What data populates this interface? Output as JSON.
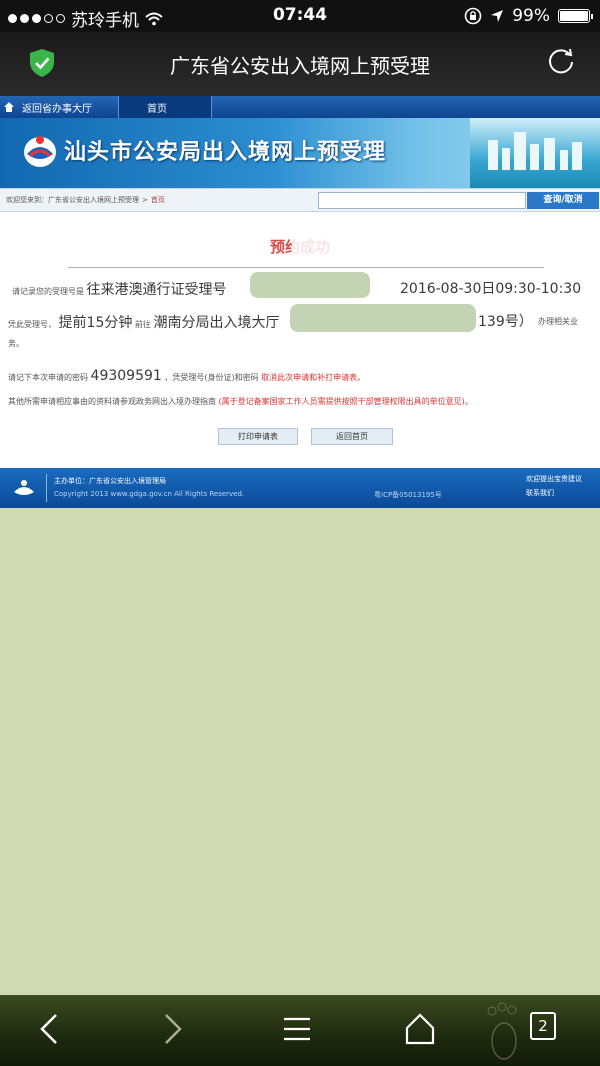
{
  "status_bar": {
    "carrier": "苏玲手机",
    "time": "07:44",
    "battery": "99%",
    "battery_level": 0.99
  },
  "browser": {
    "title": "广东省公安出入境网上预受理"
  },
  "site": {
    "nav": {
      "back_label": "返回省办事大厅",
      "home_label": "首页"
    },
    "banner_title": "汕头市公安局出入境网上预受理",
    "breadcrumb": {
      "prefix": "欢迎您来到：广东省公安出入境网上预受理",
      "separator": ">",
      "current": "首页"
    },
    "search_button": "查询/取消"
  },
  "content": {
    "heading": "预约成功",
    "line1_prefix": "请记录您的受理号是",
    "line1_business": "往来港澳通行证受理号",
    "line1_datetime": "2016-08-30日09:30-10:30",
    "line2_prefix": "凭此受理号，",
    "line2_early": "提前15分钟",
    "line2_goto": "前往",
    "line2_place": "潮南分局出入境大厅",
    "line2_addr_end": "139号）",
    "line2_suffix": "办理相关业",
    "line3": "务。",
    "line4_prefix": "请记下本次申请的密码",
    "line4_password": "49309591",
    "line4_mid": "，凭受理号(身份证)和密码",
    "line4_link": "取消此次申请和补打申请表。",
    "line5_prefix": "其他所需申请相应事由的资料请参观政务网出入境办理指南",
    "line5_red": "(属于登记备案国家工作人员需提供按照干部管理权限出具的单位意见)。",
    "buttons": {
      "print": "打印申请表",
      "home": "返回首页"
    }
  },
  "footer": {
    "org": "主办单位：广东省公安出入境管理局",
    "copyright": "Copyright 2013 www.gdga.gov.cn All Rights Reserved.",
    "icp": "粤ICP备05013195号",
    "link1": "欢迎提出宝贵建议",
    "link2": "联系我们"
  },
  "toolbar": {
    "tab_count": "2"
  },
  "colors": {
    "page_background": "#cfdab3",
    "site_blue": "#1b6cc0",
    "alert_red": "#d84c4c"
  }
}
